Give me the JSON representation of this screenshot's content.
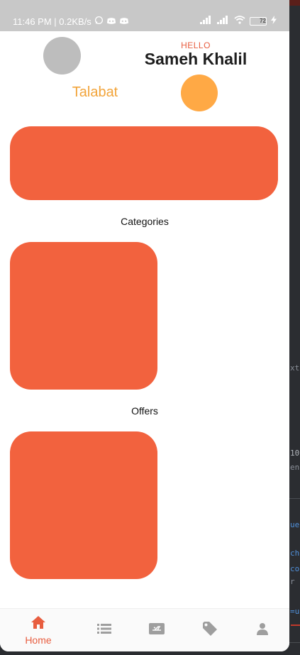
{
  "status_bar": {
    "time": "11:46 PM | 0.2KB/s",
    "battery": "72"
  },
  "header": {
    "greeting": "HELLO",
    "user_name": "Sameh Khalil",
    "brand": "Talabat"
  },
  "sections": {
    "categories_title": "Categories",
    "offers_title": "Offers"
  },
  "bottom_nav": {
    "items": [
      {
        "label": "Home",
        "icon": "home-icon",
        "active": true
      },
      {
        "label": "",
        "icon": "list-icon",
        "active": false
      },
      {
        "label": "",
        "icon": "ticket-icon",
        "active": false
      },
      {
        "label": "",
        "icon": "tag-icon",
        "active": false
      },
      {
        "label": "",
        "icon": "person-icon",
        "active": false
      }
    ]
  },
  "ide_background": {
    "snippets": [
      "xt",
      "10",
      "en",
      "ue",
      "ch",
      "co",
      "r",
      "=u"
    ]
  },
  "colors": {
    "primary": "#f2623e",
    "accent_orange": "#ffa945",
    "brand_text": "#f2a43a",
    "placeholder_grey": "#bdbdbd",
    "inactive_icon": "#9e9e9e"
  }
}
